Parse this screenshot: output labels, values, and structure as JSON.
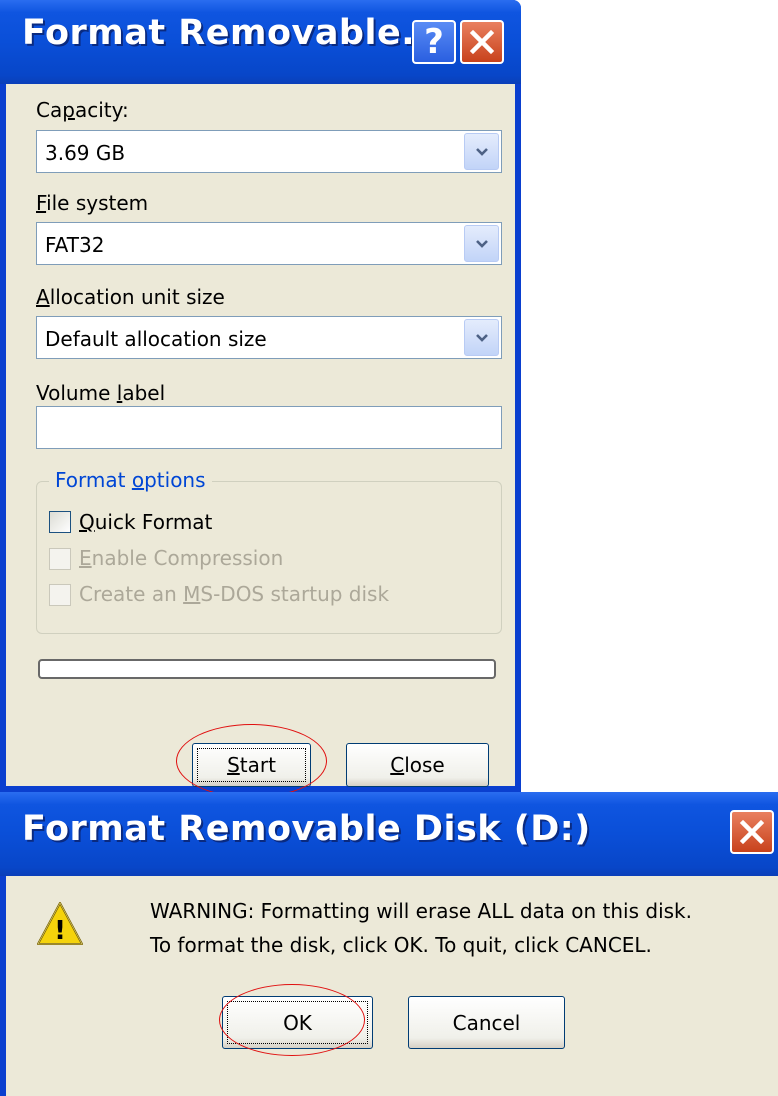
{
  "format_dialog": {
    "title": "Format Removable...",
    "help_glyph": "?",
    "capacity": {
      "label_pre": "Ca",
      "label_hotkey": "p",
      "label_post": "acity:",
      "value": "3.69 GB"
    },
    "file_system": {
      "label_pre": "",
      "label_hotkey": "F",
      "label_post": "ile system",
      "value": "FAT32"
    },
    "allocation": {
      "label_pre": "",
      "label_hotkey": "A",
      "label_post": "llocation unit size",
      "value": "Default allocation size"
    },
    "volume_label": {
      "label_pre": "Volume ",
      "label_hotkey": "l",
      "label_post": "abel",
      "value": ""
    },
    "format_options": {
      "legend_pre": "Format ",
      "legend_hotkey": "o",
      "legend_post": "ptions",
      "quick_format": {
        "hotkey": "Q",
        "rest": "uick Format",
        "checked": false,
        "enabled": true
      },
      "enable_compression": {
        "hotkey": "E",
        "rest": "nable Compression",
        "checked": false,
        "enabled": false
      },
      "ms_dos": {
        "pre": "Create an ",
        "hotkey": "M",
        "rest": "S-DOS startup disk",
        "checked": false,
        "enabled": false
      }
    },
    "progress": 0,
    "start_button": {
      "hotkey": "S",
      "rest": "tart"
    },
    "close_button": {
      "hotkey": "C",
      "rest": "lose"
    }
  },
  "warning_dialog": {
    "title": "Format Removable Disk (D:)",
    "line1": "WARNING: Formatting will erase ALL data on this disk.",
    "line2": "To format the disk, click OK. To quit, click CANCEL.",
    "warning_icon_glyph": "!",
    "ok_label": "OK",
    "cancel_label": "Cancel"
  },
  "colors": {
    "title_bar": "#0a4fd8",
    "dialog_bg": "#ece9d8",
    "highlight_circle": "#e01010",
    "group_legend": "#0046d5"
  },
  "icons": [
    "help-icon",
    "close-icon",
    "chevron-down-icon",
    "warning-icon"
  ]
}
